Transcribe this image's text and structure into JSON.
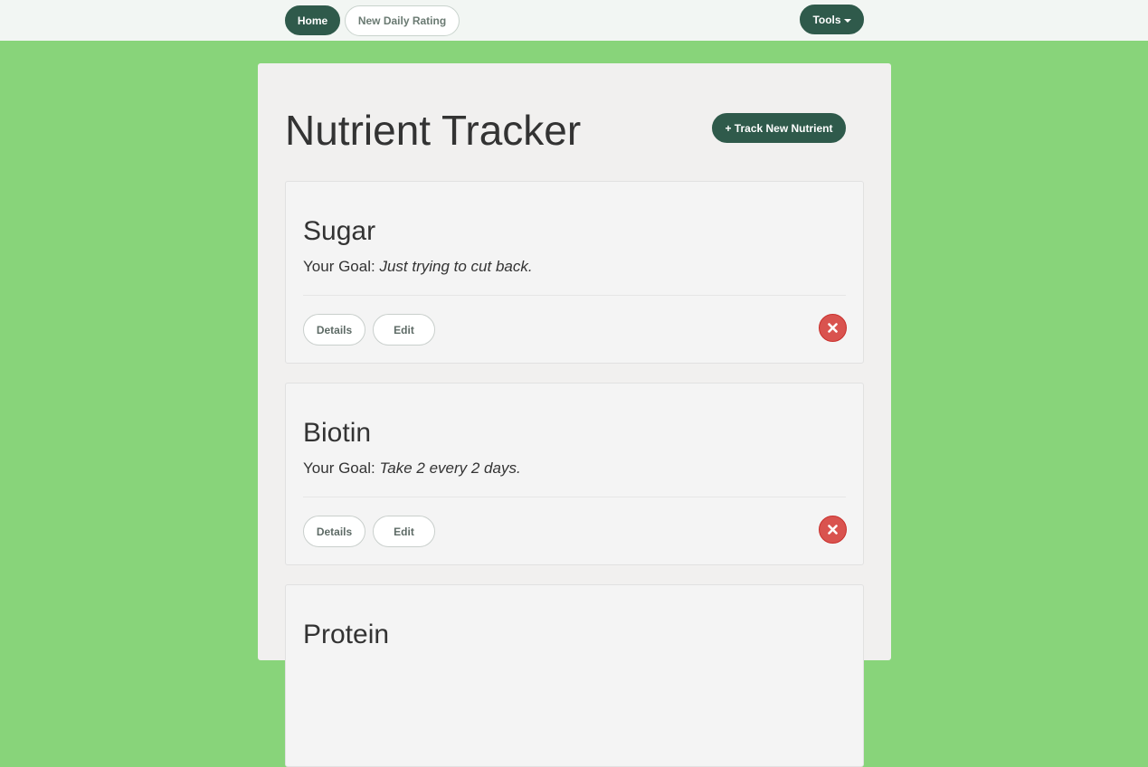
{
  "nav": {
    "home_label": "Home",
    "new_rating_label": "New Daily Rating",
    "tools_label": "Tools"
  },
  "page": {
    "title": "Nutrient Tracker",
    "track_new_label": "+ Track New Nutrient"
  },
  "nutrients": [
    {
      "name": "Sugar",
      "goal_prefix": "Your Goal:",
      "goal_text": "Just trying to cut back.",
      "details_label": "Details",
      "edit_label": "Edit",
      "delete_icon": "close-icon"
    },
    {
      "name": "Biotin",
      "goal_prefix": "Your Goal:",
      "goal_text": "Take 2 every 2 days.",
      "details_label": "Details",
      "edit_label": "Edit",
      "delete_icon": "close-icon"
    },
    {
      "name": "Protein"
    }
  ],
  "colors": {
    "background": "#88d47a",
    "primary": "#2f5a4b",
    "danger": "#d9534f",
    "navbar": "#f2f6f3",
    "panel": "#f1f0ef"
  }
}
